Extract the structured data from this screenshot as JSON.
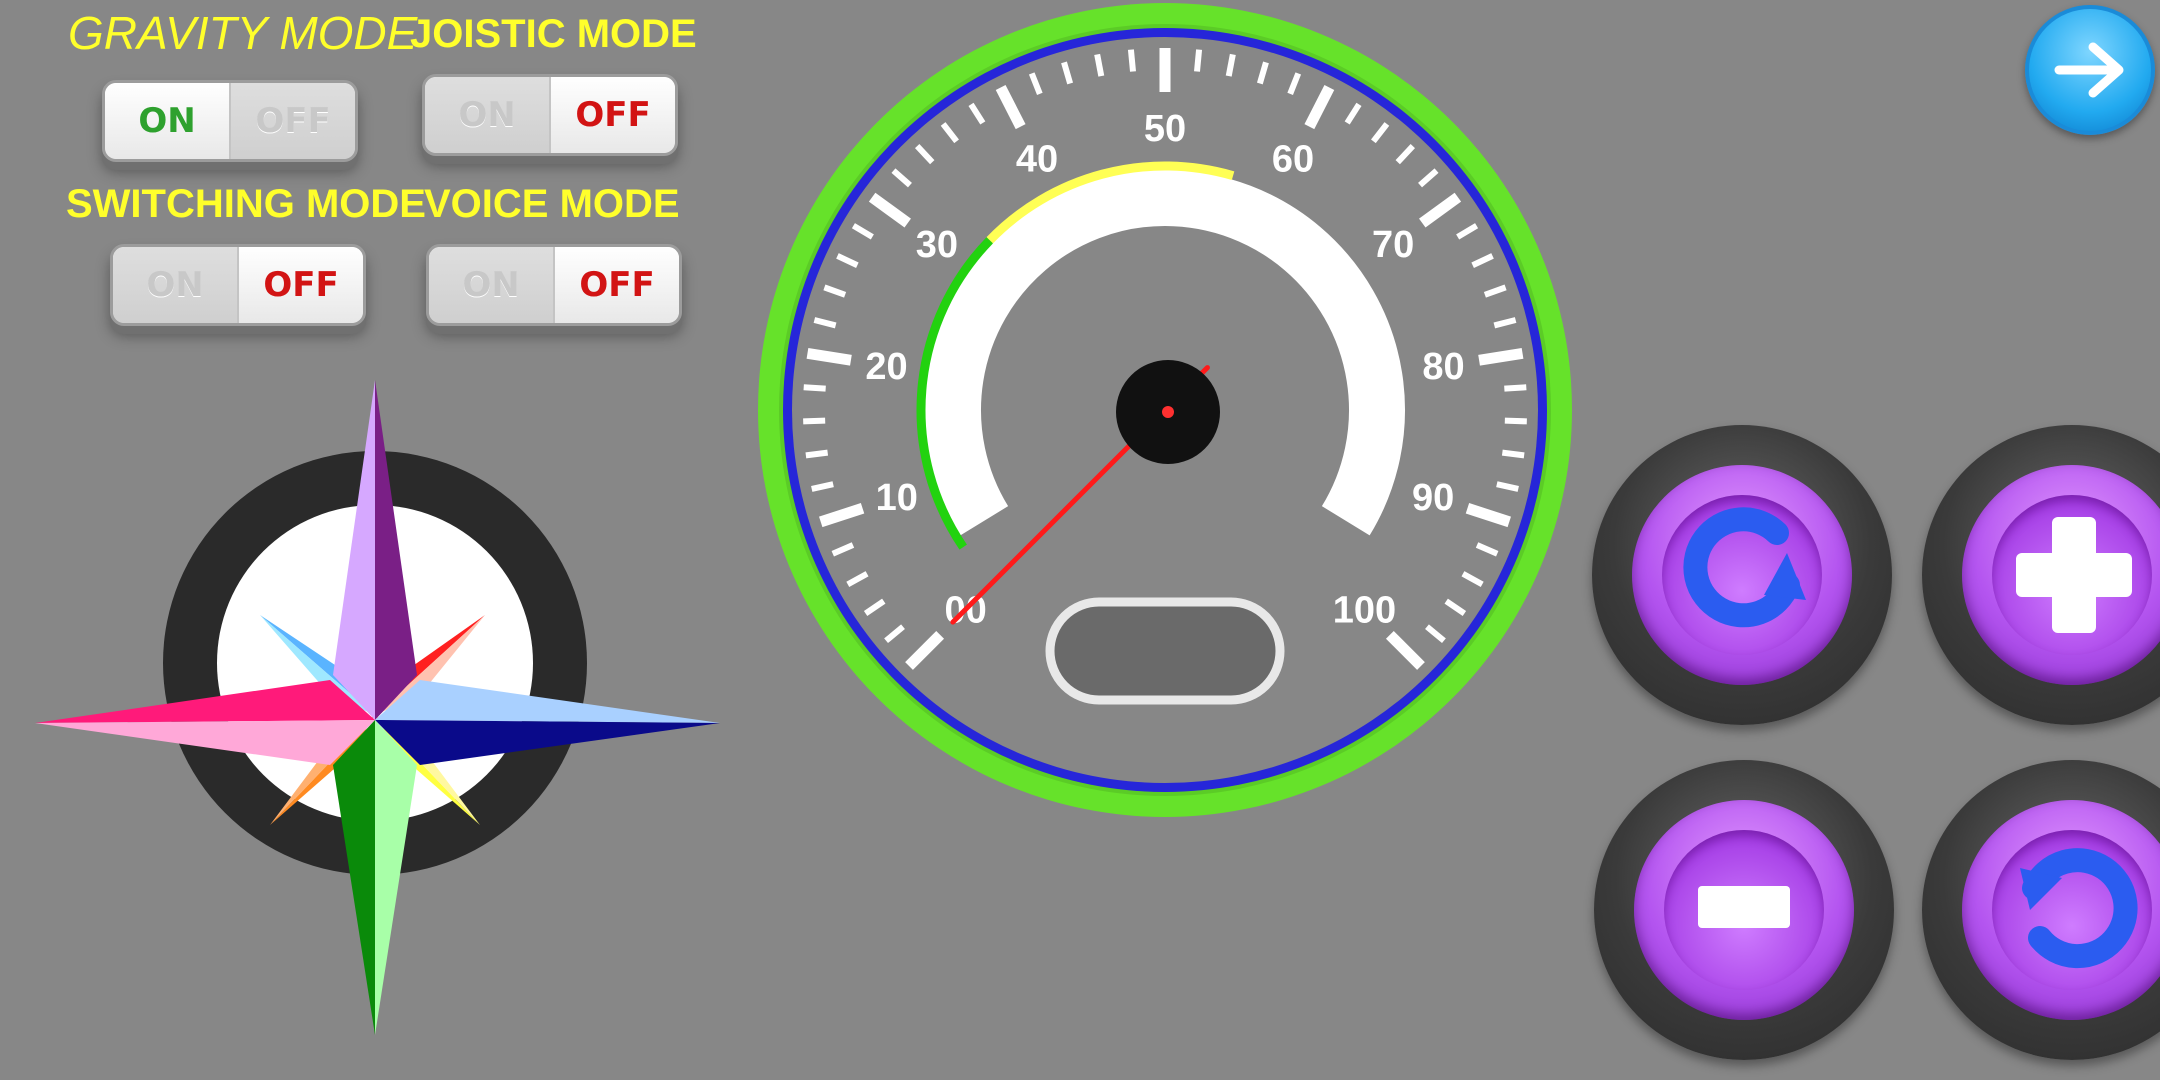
{
  "modes": {
    "gravity": {
      "label": "GRAVITY MODE",
      "on_text": "ON",
      "off_text": "OFF",
      "state": "ON"
    },
    "joystick": {
      "label": "JOISTIC MODE",
      "on_text": "ON",
      "off_text": "OFF",
      "state": "OFF"
    },
    "switching": {
      "label": "SWITCHING MODE",
      "on_text": "ON",
      "off_text": "OFF",
      "state": "OFF"
    },
    "voice": {
      "label": "VOICE MODE",
      "on_text": "ON",
      "off_text": "OFF",
      "state": "OFF"
    }
  },
  "speedometer": {
    "tick_labels": [
      "00",
      "10",
      "20",
      "30",
      "40",
      "50",
      "60",
      "70",
      "80",
      "90",
      "100"
    ],
    "min": 0,
    "max": 100,
    "needle_value": 0,
    "readout": "",
    "colors": {
      "bezel": "#66e22a",
      "ring": "#2626d9",
      "green_zone": "#22d20f",
      "yellow_zone": "#ffff55",
      "needle": "#ff1a1a"
    }
  },
  "controls": {
    "next_icon": "arrow-right-icon",
    "rotate_cw_icon": "rotate-clockwise-icon",
    "plus_icon": "plus-icon",
    "minus_icon": "minus-icon",
    "rotate_ccw_icon": "rotate-counterclockwise-icon"
  },
  "compass": {
    "icon": "compass-rose-icon"
  }
}
